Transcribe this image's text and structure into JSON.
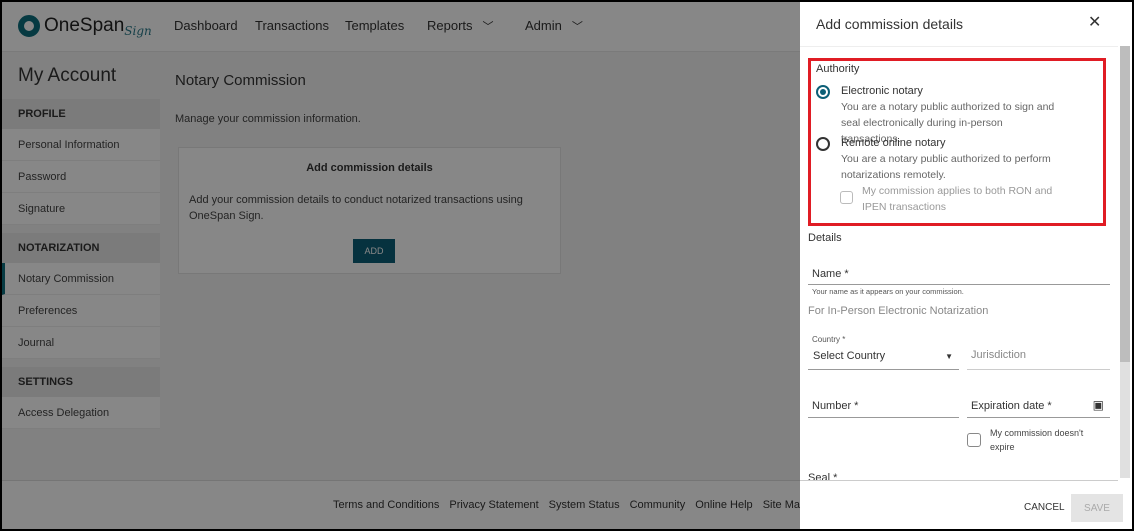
{
  "header": {
    "logo": "OneSpan",
    "logo_sub": "Sign",
    "nav": [
      "Dashboard",
      "Transactions",
      "Templates",
      "Reports",
      "Admin"
    ]
  },
  "sidebar": {
    "title": "My Account",
    "sections": [
      {
        "label": "PROFILE",
        "items": [
          "Personal Information",
          "Password",
          "Signature"
        ]
      },
      {
        "label": "NOTARIZATION",
        "items": [
          "Notary Commission",
          "Preferences",
          "Journal"
        ]
      },
      {
        "label": "SETTINGS",
        "items": [
          "Access Delegation"
        ]
      }
    ],
    "active": "Notary Commission"
  },
  "main": {
    "title": "Notary Commission",
    "description": "Manage your commission information.",
    "card": {
      "title": "Add commission details",
      "text": "Add your commission details to conduct notarized transactions using OneSpan Sign.",
      "button": "ADD"
    }
  },
  "footer": {
    "links": [
      "Terms and Conditions",
      "Privacy Statement",
      "System Status",
      "Community",
      "Online Help",
      "Site Map"
    ]
  },
  "drawer": {
    "title": "Add commission details",
    "authority_label": "Authority",
    "options": [
      {
        "label": "Electronic notary",
        "desc": "You are a notary public authorized to sign and seal electronically during in-person transactions.",
        "selected": true
      },
      {
        "label": "Remote online notary",
        "desc": "You are a notary public authorized to perform notarizations remotely.",
        "selected": false
      }
    ],
    "both_checkbox": "My commission applies to both RON and IPEN transactions",
    "details_label": "Details",
    "name_label": "Name *",
    "name_hint": "Your name as it appears on your commission.",
    "ipen_label": "For In-Person Electronic Notarization",
    "country_label": "Country *",
    "country_value": "Select Country",
    "jurisdiction": "Jurisdiction",
    "number": "Number *",
    "expiration": "Expiration date *",
    "no_expire": "My commission doesn't expire",
    "seal": "Seal *",
    "cancel": "CANCEL",
    "save": "SAVE",
    "highlight_color": "#e01c24",
    "accent": "#0c5f77"
  }
}
